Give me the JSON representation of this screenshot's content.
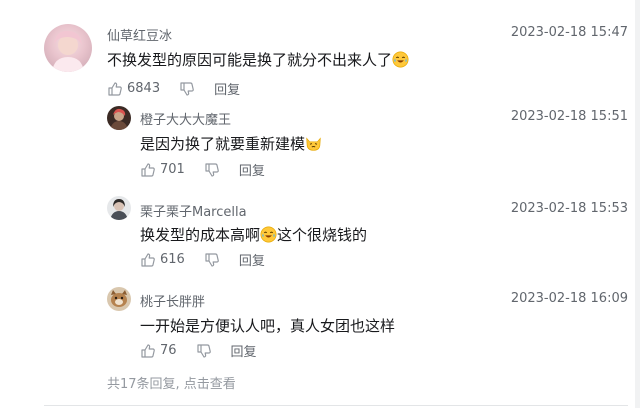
{
  "main_comment": {
    "username": "仙草红豆冰",
    "time": "2023-02-18 15:47",
    "text": "不换发型的原因可能是换了就分不出来人了",
    "emoji": "laugh-cry-emoji",
    "likes": "6843",
    "reply_label": "回复"
  },
  "replies": [
    {
      "username": "橙子大大大魔王",
      "time": "2023-02-18 15:51",
      "text": "是因为换了就要重新建模",
      "emoji": "cat-emoji",
      "likes": "701",
      "reply_label": "回复"
    },
    {
      "username": "栗子栗子Marcella",
      "time": "2023-02-18 15:53",
      "text_before": "换发型的成本高啊",
      "emoji": "laugh-cry-emoji",
      "text_after": "这个很烧钱的",
      "likes": "616",
      "reply_label": "回复"
    },
    {
      "username": "桃子长胖胖",
      "time": "2023-02-18 16:09",
      "text": "一开始是方便认人吧，真人女团也这样",
      "likes": "76",
      "reply_label": "回复"
    }
  ],
  "footer": {
    "more_text": "共17条回复, 点击查看"
  },
  "colors": {
    "text": "#18191c",
    "meta": "#61666d",
    "divider": "#e3e5e7"
  }
}
